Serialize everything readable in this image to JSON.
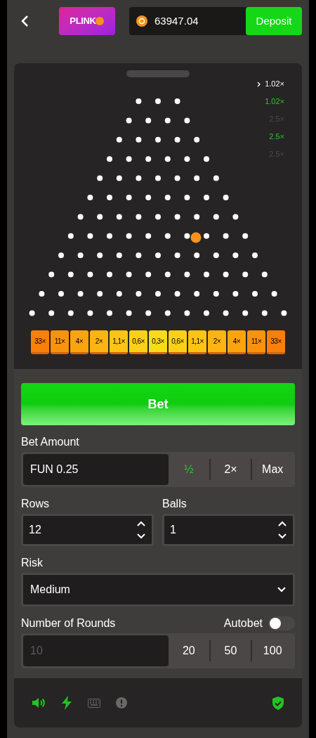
{
  "header": {
    "logo": "PLINK",
    "balance": "63947.04",
    "deposit": "Deposit"
  },
  "history": [
    {
      "kind": "current",
      "value": "1.02×"
    },
    {
      "kind": "win",
      "value": "1.02×"
    },
    {
      "kind": "loss",
      "value": "2.5×"
    },
    {
      "kind": "win",
      "value": "2.5×"
    },
    {
      "kind": "loss",
      "value": "2.5×"
    }
  ],
  "multipliers": [
    {
      "label": "33×",
      "color": "#f77f0a"
    },
    {
      "label": "11×",
      "color": "#f9920c"
    },
    {
      "label": "4×",
      "color": "#fba40f"
    },
    {
      "label": "2×",
      "color": "#fcb412"
    },
    {
      "label": "1,1×",
      "color": "#fcc415"
    },
    {
      "label": "0,6×",
      "color": "#fbd117"
    },
    {
      "label": "0,3×",
      "color": "#f9dc18"
    },
    {
      "label": "0,6×",
      "color": "#fbd117"
    },
    {
      "label": "1,1×",
      "color": "#fcc415"
    },
    {
      "label": "2×",
      "color": "#fcb412"
    },
    {
      "label": "4×",
      "color": "#fba40f"
    },
    {
      "label": "11×",
      "color": "#f9920c"
    },
    {
      "label": "33×",
      "color": "#f77f0a"
    }
  ],
  "bet_button": "Bet",
  "bet_amount": {
    "label": "Bet Amount",
    "value": "FUN 0.25",
    "options": [
      {
        "label": "½",
        "selected": true
      },
      {
        "label": "2×",
        "selected": false
      },
      {
        "label": "Max",
        "selected": false
      }
    ]
  },
  "rows": {
    "label": "Rows",
    "value": "12"
  },
  "balls": {
    "label": "Balls",
    "value": "1"
  },
  "risk": {
    "label": "Risk",
    "value": "Medium"
  },
  "rounds": {
    "label": "Number of Rounds",
    "placeholder": "10",
    "options": [
      "20",
      "50",
      "100"
    ]
  },
  "autobet": {
    "label": "Autobet",
    "on": false
  },
  "footer": {
    "toggles": [
      {
        "kind": "sound",
        "on": true
      },
      {
        "kind": "turbo",
        "on": true
      },
      {
        "kind": "keyboard",
        "on": false
      },
      {
        "kind": "info",
        "on": false
      }
    ]
  }
}
